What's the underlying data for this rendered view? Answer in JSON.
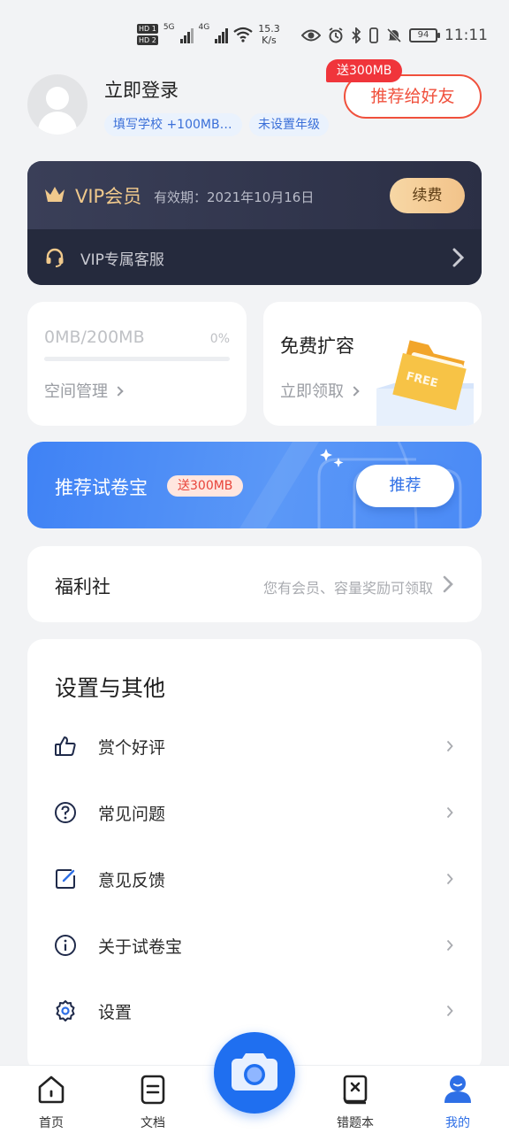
{
  "status_bar": {
    "hd1": "HD 1",
    "hd2": "HD 2",
    "net1": "5G",
    "net2": "4G",
    "speed_value": "15.3",
    "speed_unit": "K/s",
    "battery": "94",
    "time": "11:11"
  },
  "profile": {
    "login_label": "立即登录",
    "school_tag": "填写学校 +100MB…",
    "grade_tag": "未设置年级",
    "recommend_button": "推荐给好友",
    "recommend_gift": "送300MB"
  },
  "vip": {
    "title": "VIP会员",
    "expire": "有效期：2021年10月16日",
    "renew_button": "续费",
    "service_label": "VIP专属客服"
  },
  "storage": {
    "usage": "0MB/200MB",
    "percent_label": "0%",
    "used_fraction": 0.0,
    "manage_link": "空间管理"
  },
  "free_expand": {
    "title": "免费扩容",
    "claim_link": "立即领取",
    "folder_text": "FREE"
  },
  "banner": {
    "title": "推荐试卷宝",
    "badge": "送300MB",
    "button": "推荐"
  },
  "welfare": {
    "title": "福利社",
    "hint": "您有会员、容量奖励可领取"
  },
  "settings": {
    "title": "设置与其他",
    "items": [
      {
        "label": "赏个好评",
        "icon": "thumbs-up-icon"
      },
      {
        "label": "常见问题",
        "icon": "question-icon"
      },
      {
        "label": "意见反馈",
        "icon": "feedback-edit-icon"
      },
      {
        "label": "关于试卷宝",
        "icon": "info-icon"
      },
      {
        "label": "设置",
        "icon": "gear-icon"
      }
    ]
  },
  "bottom_nav": {
    "items": [
      {
        "label": "首页",
        "icon": "home-icon"
      },
      {
        "label": "文档",
        "icon": "document-icon"
      },
      {
        "label": "错题本",
        "icon": "mistake-book-icon"
      },
      {
        "label": "我的",
        "icon": "profile-icon",
        "active": true
      }
    ],
    "camera_icon": "camera-icon"
  },
  "colors": {
    "accent": "#2e6fe6",
    "vip_gold": "#f0c98c",
    "alert_red": "#f0503c"
  }
}
